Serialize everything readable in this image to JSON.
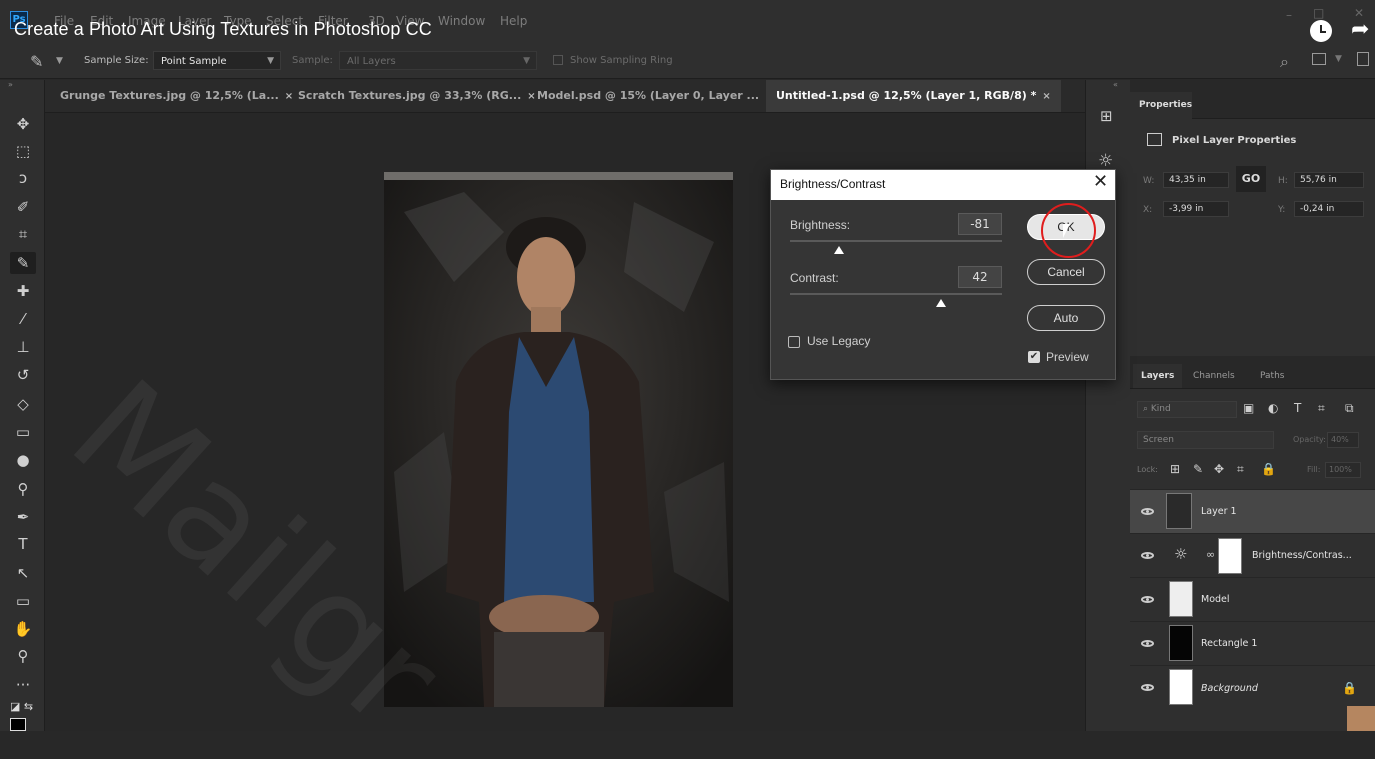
{
  "video": {
    "title": "Create a Photo Art Using Textures in Photoshop CC"
  },
  "app": {
    "logo": "Ps"
  },
  "menu": [
    "File",
    "Edit",
    "Image",
    "Layer",
    "Type",
    "Select",
    "Filter",
    "3D",
    "View",
    "Window",
    "Help"
  ],
  "window_controls": {
    "minimize": "–",
    "maximize": "□",
    "close": "✕"
  },
  "options_bar": {
    "sample_size_label": "Sample Size:",
    "sample_size_value": "Point Sample",
    "sample_label": "Sample:",
    "sample_value": "All Layers",
    "show_sampling_ring": "Show Sampling Ring"
  },
  "tabs": [
    {
      "label": "Grunge Textures.jpg @ 12,5% (La...",
      "close": "×"
    },
    {
      "label": "Scratch Textures.jpg @ 33,3% (RG...",
      "close": "×"
    },
    {
      "label": "Model.psd @ 15% (Layer 0, Layer ...",
      "close": "×"
    },
    {
      "label": "Untitled-1.psd @ 12,5% (Layer 1, RGB/8) *",
      "close": "×"
    }
  ],
  "dialog": {
    "title": "Brightness/Contrast",
    "close": "✕",
    "brightness_label": "Brightness:",
    "brightness_value": "-81",
    "brightness_slider_fraction": 0.23,
    "contrast_label": "Contrast:",
    "contrast_value": "42",
    "contrast_slider_fraction": 0.71,
    "use_legacy_label": "Use Legacy",
    "use_legacy_checked": false,
    "preview_label": "Preview",
    "preview_checked": true,
    "ok_label": "OK",
    "cancel_label": "Cancel",
    "auto_label": "Auto"
  },
  "properties": {
    "tab_label": "Properties",
    "title": "Pixel Layer Properties",
    "w_label": "W:",
    "w_value": "43,35 in",
    "h_label": "H:",
    "h_value": "55,76 in",
    "x_label": "X:",
    "x_value": "-3,99 in",
    "y_label": "Y:",
    "y_value": "-0,24 in",
    "link_glyph": "GO"
  },
  "layers_panel": {
    "tabs": [
      "Layers",
      "Channels",
      "Paths"
    ],
    "kind_placeholder": "Kind",
    "blend_mode": "Screen",
    "opacity_label": "Opacity:",
    "opacity_value": "40%",
    "lock_label": "Lock:",
    "fill_label": "Fill:",
    "fill_value": "100%",
    "layers": [
      {
        "name": "Layer 1",
        "selected": true
      },
      {
        "name": "Brightness/Contras...",
        "selected": false
      },
      {
        "name": "Model",
        "selected": false
      },
      {
        "name": "Rectangle 1",
        "selected": false
      },
      {
        "name": "Background",
        "selected": false,
        "locked": true
      }
    ]
  },
  "watermark": "Mailgr",
  "colors": {
    "accent": "#31a8ff",
    "click_ring": "#e01d1d",
    "dialog_bg": "#353535",
    "panel_bg": "#2f2f2f"
  }
}
